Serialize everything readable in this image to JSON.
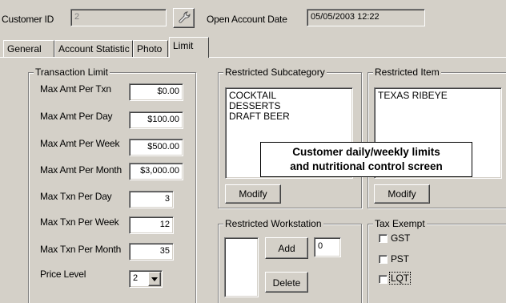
{
  "header": {
    "customer_id_label": "Customer ID",
    "customer_id_value": "2",
    "open_date_label": "Open Account Date",
    "open_date_value": "05/05/2003 12:22"
  },
  "tabs": [
    {
      "label": "General"
    },
    {
      "label": "Account Statistic"
    },
    {
      "label": "Photo"
    },
    {
      "label": "Limit"
    }
  ],
  "transaction_limit": {
    "title": "Transaction Limit",
    "rows": [
      {
        "label": "Max Amt Per Txn",
        "value": "$0.00"
      },
      {
        "label": "Max Amt Per Day",
        "value": "$100.00"
      },
      {
        "label": "Max Amt Per Week",
        "value": "$500.00"
      },
      {
        "label": "Max Amt Per Month",
        "value": "$3,000.00"
      },
      {
        "label": "Max Txn Per Day",
        "value": "3"
      },
      {
        "label": "Max Txn Per Week",
        "value": "12"
      },
      {
        "label": "Max Txn Per Month",
        "value": "35"
      }
    ],
    "price_level_label": "Price Level",
    "price_level_value": "2"
  },
  "restricted_subcategory": {
    "title": "Restricted Subcategory",
    "items": [
      "COCKTAIL",
      "DESSERTS",
      "DRAFT BEER"
    ],
    "modify_label": "Modify"
  },
  "restricted_item": {
    "title": "Restricted Item",
    "items": [
      "TEXAS RIBEYE"
    ],
    "modify_label": "Modify"
  },
  "restricted_workstation": {
    "title": "Restricted Workstation",
    "add_label": "Add",
    "add_value": "0",
    "delete_label": "Delete"
  },
  "tax_exempt": {
    "title": "Tax Exempt",
    "options": [
      {
        "label": "GST",
        "checked": false
      },
      {
        "label": "PST",
        "checked": false
      },
      {
        "label": "LQT",
        "checked": false
      }
    ]
  },
  "caption": {
    "line1": "Customer daily/weekly limits",
    "line2": "and nutritional control screen"
  },
  "icons": {
    "lookup": "wrench-icon",
    "dropdown": "chevron-down-icon"
  }
}
